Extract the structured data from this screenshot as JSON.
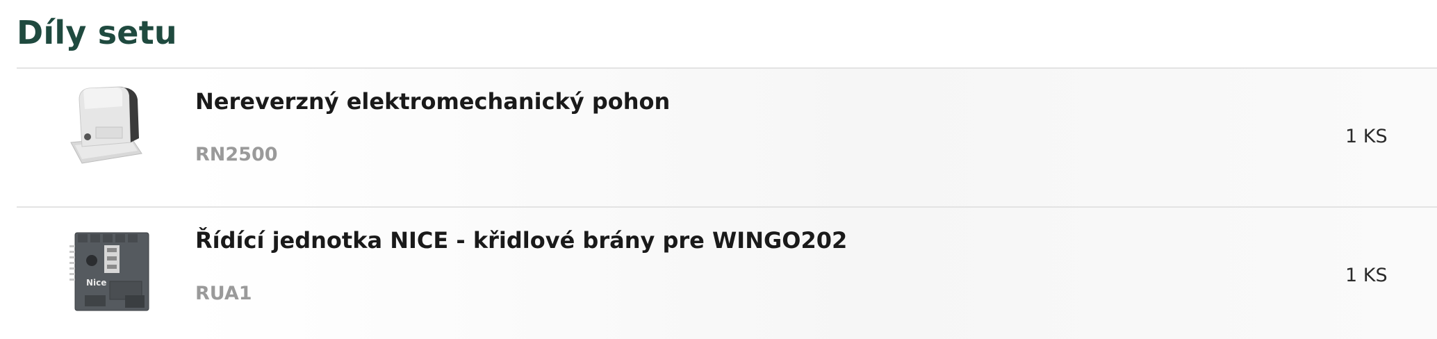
{
  "section": {
    "title": "Díly setu"
  },
  "parts": [
    {
      "name": "Nereverzný elektromechanický pohon",
      "code": "RN2500",
      "quantity": "1 KS",
      "image_icon": "gate-motor-image"
    },
    {
      "name": "Řídící jednotka NICE - křidlové brány pre WINGO202",
      "code": "RUA1",
      "quantity": "1 KS",
      "image_icon": "control-unit-image",
      "image_brand_text": "Nice"
    }
  ],
  "colors": {
    "title": "#1f4a3f",
    "code": "#9a9a9a",
    "divider": "#e3e3e3"
  }
}
